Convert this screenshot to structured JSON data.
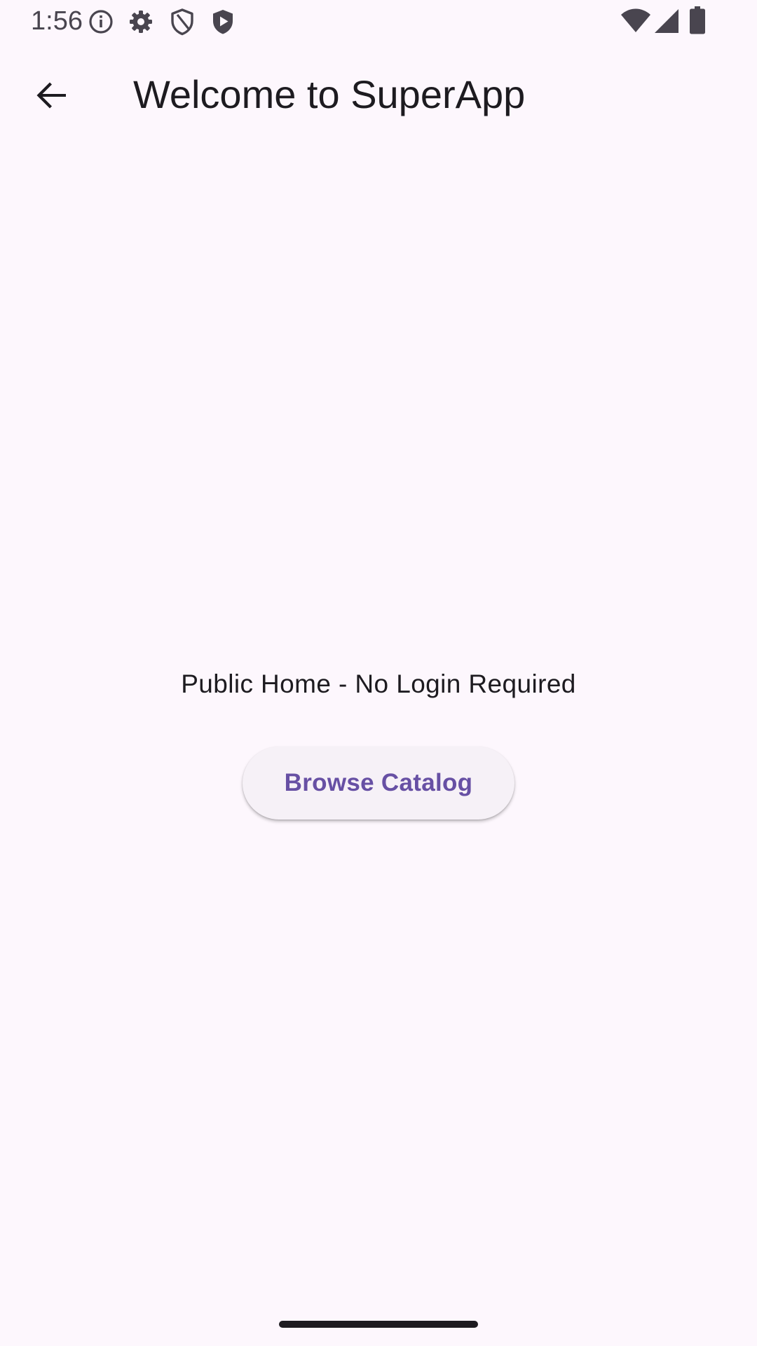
{
  "status_bar": {
    "time": "1:56",
    "left_icons": [
      "info-icon",
      "settings-gear-icon",
      "shield-outline-icon",
      "shield-play-icon"
    ],
    "right_icons": [
      "wifi-icon",
      "cell-signal-icon",
      "battery-icon"
    ]
  },
  "app_bar": {
    "back_icon": "arrow-back-icon",
    "title": "Welcome to SuperApp"
  },
  "content": {
    "message": "Public Home - No Login Required",
    "browse_button_label": "Browse Catalog"
  },
  "colors": {
    "background": "#FDF7FD",
    "button_background": "#F6F1F7",
    "accent": "#6750A4",
    "text": "#1D1B20"
  }
}
